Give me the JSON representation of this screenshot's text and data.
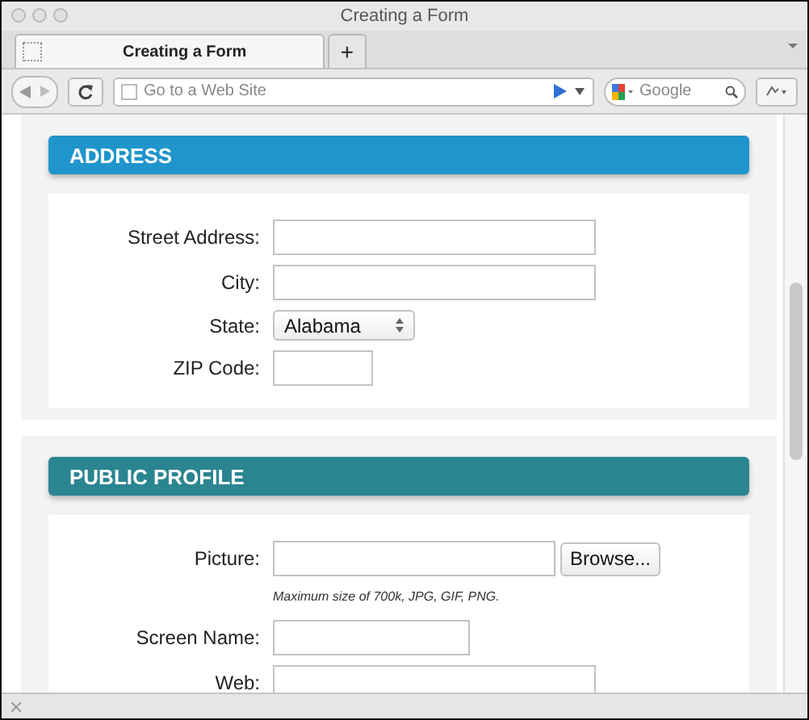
{
  "window": {
    "title": "Creating a Form"
  },
  "tabs": [
    {
      "label": "Creating a Form",
      "selected": true
    },
    {
      "label": "+",
      "selected": false
    }
  ],
  "toolbar": {
    "address_placeholder": "Go to a Web Site",
    "search_placeholder": "Google"
  },
  "sections": [
    {
      "title": "ADDRESS",
      "color": "#1f95cc",
      "fields": [
        {
          "label": "Street Address:",
          "kind": "text"
        },
        {
          "label": "City:",
          "kind": "text"
        },
        {
          "label": "State:",
          "kind": "select",
          "value": "Alabama"
        },
        {
          "label": "ZIP Code:",
          "kind": "short"
        }
      ]
    },
    {
      "title": "PUBLIC PROFILE",
      "color": "#2b8590",
      "fields": [
        {
          "label": "Picture:",
          "kind": "file",
          "button": "Browse...",
          "hint": "Maximum size of 700k, JPG, GIF, PNG."
        },
        {
          "label": "Screen Name:",
          "kind": "medium"
        },
        {
          "label": "Web:",
          "kind": "text"
        }
      ]
    }
  ]
}
